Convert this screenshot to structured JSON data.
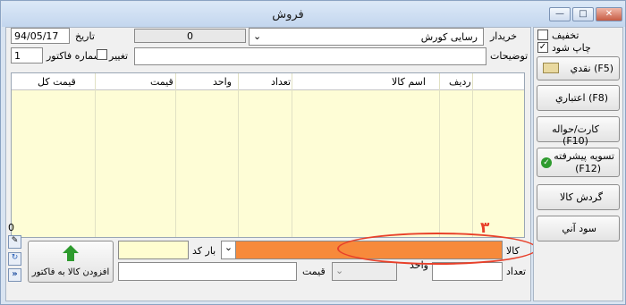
{
  "window": {
    "title": "فروش",
    "min_icon": "minimize-icon",
    "max_icon": "maximize-icon",
    "close_icon": "close-icon"
  },
  "header": {
    "date_label": "تاریخ",
    "date_value": "94/05/17",
    "counter_value": "0",
    "customer_label": "خريدار",
    "customer_value": "رسایی کورش",
    "invoice_label": "شماره  فاکتور",
    "invoice_value": "1",
    "change_label": "تغییر",
    "notes_label": "توضيحات",
    "notes_value": ""
  },
  "options": {
    "discount_label": "تخفیف",
    "discount_checked": false,
    "print_label": "چاپ شود",
    "print_checked": true
  },
  "grid": {
    "columns": [
      "رديف",
      "اسم کالا",
      "تعداد",
      "واحد",
      "قيمت",
      "قيمت کل"
    ],
    "rows": []
  },
  "side_buttons": {
    "cash": "نقدي (F5)",
    "credit": "اعتباري (F8)",
    "card": "کارت/حواله (F10)",
    "advanced_line1": "تسویه پیشرفته",
    "advanced_line2": "(F12)",
    "turnover": "گردش کالا",
    "profit": "سود آني"
  },
  "entry": {
    "goods_label": "کالا",
    "goods_value": "",
    "barcode_label": "بار کد",
    "barcode_value": "",
    "quantity_label": "تعداد",
    "quantity_value": "",
    "unit_label": "واحد",
    "unit_value": "",
    "price_label": "قيمت",
    "price_value": "",
    "add_button": "افزودن کالا به فاکتور",
    "left_counter": "0"
  },
  "annotation": {
    "number": "۳",
    "color": "#e8402a"
  },
  "colors": {
    "grid_bg": "#fefdd6",
    "goods_input": "#f78a3b",
    "barcode_input": "#fffdd0",
    "accent_green": "#2e9b2e"
  }
}
